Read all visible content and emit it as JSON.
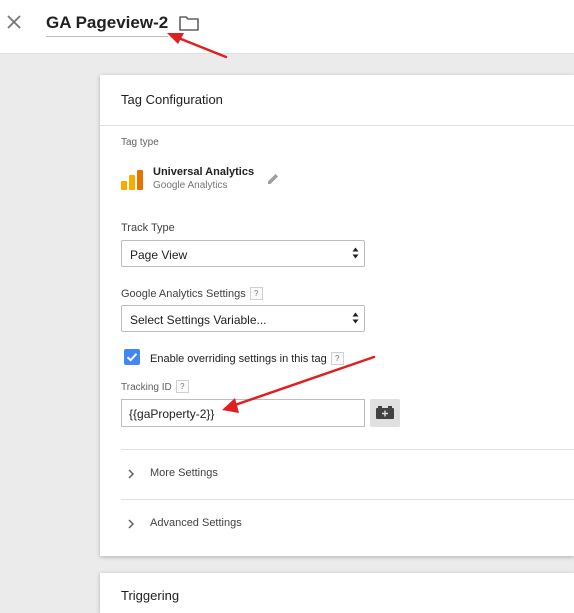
{
  "header": {
    "tag_name": "GA Pageview-2"
  },
  "card": {
    "title": "Tag Configuration",
    "tag_type_label": "Tag type",
    "tag_type": {
      "name": "Universal Analytics",
      "vendor": "Google Analytics"
    },
    "track_type": {
      "label": "Track Type",
      "value": "Page View"
    },
    "ga_settings": {
      "label": "Google Analytics Settings",
      "value": "Select Settings Variable..."
    },
    "override": {
      "checked": true,
      "label": "Enable overriding settings in this tag"
    },
    "tracking_id": {
      "label": "Tracking ID",
      "value": "{{gaProperty-2}}"
    },
    "sections": [
      {
        "label": "More Settings"
      },
      {
        "label": "Advanced Settings"
      }
    ]
  },
  "triggering": {
    "title": "Triggering"
  },
  "help_glyph": "?",
  "colors": {
    "accent": "#4285f4",
    "annotation": "#e02020",
    "logo": [
      "#f9ab00",
      "#f9ab00",
      "#e37400"
    ]
  },
  "icons": {
    "close": "close-icon",
    "folder": "folder-icon",
    "edit": "pencil-icon",
    "variable": "variable-picker-icon",
    "expand": "chevron-right-icon"
  }
}
